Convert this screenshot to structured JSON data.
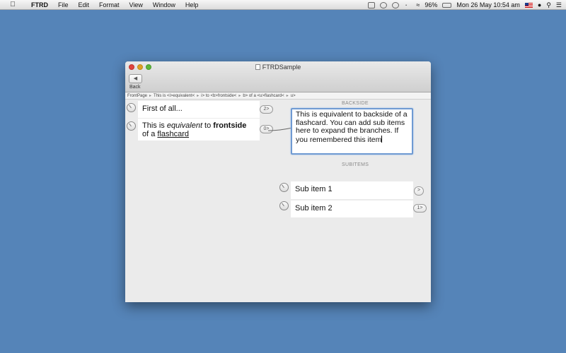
{
  "menubar": {
    "app_name": "FTRD",
    "menus": [
      "File",
      "Edit",
      "Format",
      "View",
      "Window",
      "Help"
    ],
    "battery": "96%",
    "datetime": "Mon 26 May  10:54 am"
  },
  "window": {
    "title": "FTRDSample",
    "back_label": "Back"
  },
  "breadcrumb": [
    "FrontPage",
    "This is <i>equivalent<",
    "i> to <b>frontside<",
    "b> of a <u>flashcard<",
    "u>"
  ],
  "front": {
    "items": [
      {
        "text": "First of all..."
      },
      {
        "pre": "This is ",
        "em": "equivalent",
        "mid": " to ",
        "strong": "frontside",
        "line2_pre": "of a ",
        "u": "flashcard"
      }
    ],
    "badges": [
      "2>",
      "0>"
    ]
  },
  "backside": {
    "label": "BACKSIDE",
    "text": "This is equivalent to backside of a flashcard. You can add sub items here to expand the branches. If you remembered this item"
  },
  "subitems": {
    "label": "SUBITEMS",
    "items": [
      {
        "text": "Sub item 1",
        "badge": ">"
      },
      {
        "text": "Sub item 2",
        "badge": "1>"
      }
    ]
  }
}
